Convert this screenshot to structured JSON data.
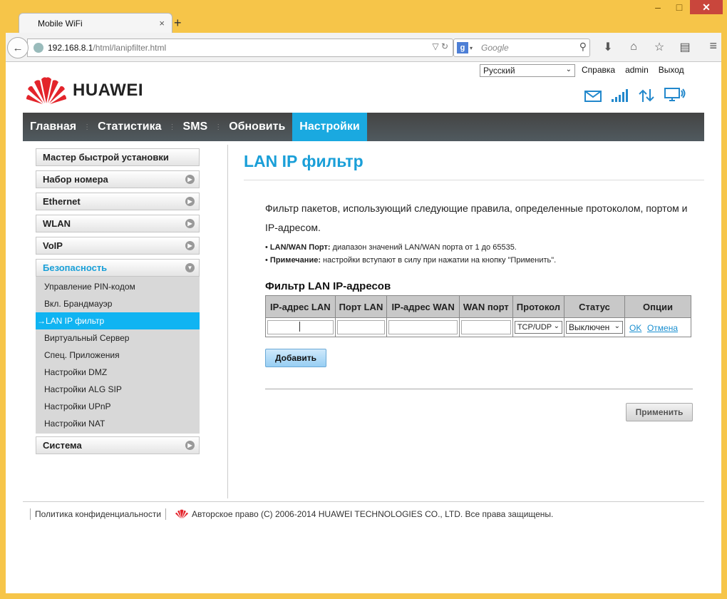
{
  "browser": {
    "tab_title": "Mobile WiFi",
    "tab_close": "×",
    "new_tab": "+",
    "url_host": "192.168.8.1",
    "url_path": "/html/lanipfilter.html",
    "search_placeholder": "Google",
    "search_engine": "g"
  },
  "header": {
    "brand": "HUAWEI",
    "language": "Русский",
    "help": "Справка",
    "user": "admin",
    "logout": "Выход"
  },
  "nav": {
    "items": [
      "Главная",
      "Статистика",
      "SMS",
      "Обновить",
      "Настройки"
    ],
    "active": "Настройки"
  },
  "sidebar": {
    "items": [
      {
        "label": "Мастер быстрой установки"
      },
      {
        "label": "Набор номера"
      },
      {
        "label": "Ethernet"
      },
      {
        "label": "WLAN"
      },
      {
        "label": "VoIP"
      },
      {
        "label": "Безопасность"
      },
      {
        "label": "Система"
      }
    ],
    "security_sub": [
      "Управление PIN-кодом",
      "Вкл. Брандмауэр",
      "→LAN IP фильтр",
      "Виртуальный Сервер",
      "Спец. Приложения",
      "Настройки DMZ",
      "Настройки ALG SIP",
      "Настройки UPnP",
      "Настройки NAT"
    ]
  },
  "content": {
    "title": "LAN IP фильтр",
    "description": "Фильтр пакетов, использующий следующие правила, определенные протоколом, портом и IP-адресом.",
    "note1_bold": "LAN/WAN Порт:",
    "note1_text": " диапазон значений LAN/WAN порта от 1 до 65535.",
    "note2_bold": "Примечание:",
    "note2_text": " настройки вступают в силу при нажатии на кнопку \"Применить\".",
    "table_title": "Фильтр LAN IP-адресов",
    "columns": [
      "IP-адрес LAN",
      "Порт LAN",
      "IP-адрес WAN",
      "WAN порт",
      "Протокол",
      "Статус",
      "Опции"
    ],
    "row": {
      "protocol": "TCP/UDP",
      "status": "Выключен",
      "ok": "OK",
      "cancel": "Отмена"
    },
    "add_button": "Добавить",
    "apply_button": "Применить"
  },
  "footer": {
    "privacy": "Политика конфиденциальности",
    "copyright": "Авторское право (C) 2006-2014 HUAWEI TECHNOLOGIES CO., LTD. Все права защищены."
  },
  "colors": {
    "accent": "#1aa9e0",
    "frame": "#f6c549"
  }
}
